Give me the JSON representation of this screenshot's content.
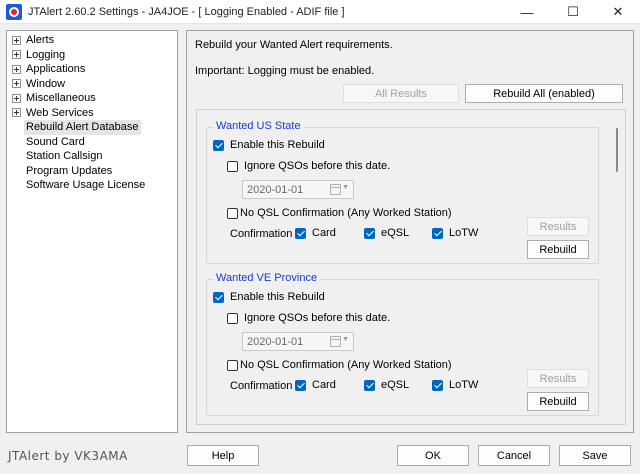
{
  "window": {
    "title": "JTAlert 2.60.2 Settings  -  JA4JOE  -  [ Logging Enabled - ADIF file ]",
    "minimize": "—",
    "maximize": "☐",
    "close": "✕"
  },
  "tree": {
    "items": [
      {
        "label": "Alerts",
        "expandable": true
      },
      {
        "label": "Logging",
        "expandable": true
      },
      {
        "label": "Applications",
        "expandable": true
      },
      {
        "label": "Window",
        "expandable": true
      },
      {
        "label": "Miscellaneous",
        "expandable": true
      },
      {
        "label": "Web Services",
        "expandable": true
      },
      {
        "label": "Rebuild Alert Database",
        "expandable": false,
        "selected": true
      },
      {
        "label": "Sound Card",
        "expandable": false
      },
      {
        "label": "Station Callsign",
        "expandable": false
      },
      {
        "label": "Program Updates",
        "expandable": false
      },
      {
        "label": "Software Usage License",
        "expandable": false
      }
    ]
  },
  "pane": {
    "intro": "Rebuild your Wanted Alert requirements.",
    "important": "Important: Logging must be enabled.",
    "all_results": "All Results",
    "rebuild_all": "Rebuild All (enabled)"
  },
  "groups": [
    {
      "title": "Wanted US State",
      "enable": "Enable this Rebuild",
      "ignore": "Ignore QSOs before this date.",
      "date": "2020-01-01",
      "noqsl": "No QSL Confirmation (Any Worked Station)",
      "confirmation": "Confirmation",
      "card": "Card",
      "eqsl": "eQSL",
      "lotw": "LoTW",
      "results": "Results",
      "rebuild": "Rebuild"
    },
    {
      "title": "Wanted VE Province",
      "enable": "Enable this Rebuild",
      "ignore": "Ignore QSOs before this date.",
      "date": "2020-01-01",
      "noqsl": "No QSL Confirmation (Any Worked Station)",
      "confirmation": "Confirmation",
      "card": "Card",
      "eqsl": "eQSL",
      "lotw": "LoTW",
      "results": "Results",
      "rebuild": "Rebuild"
    }
  ],
  "footer": {
    "brand": "JTAlert by VK3AMA",
    "help": "Help",
    "ok": "OK",
    "cancel": "Cancel",
    "save": "Save"
  },
  "colors": {
    "accent": "#0067c0",
    "group_title": "#1a3ad0"
  }
}
